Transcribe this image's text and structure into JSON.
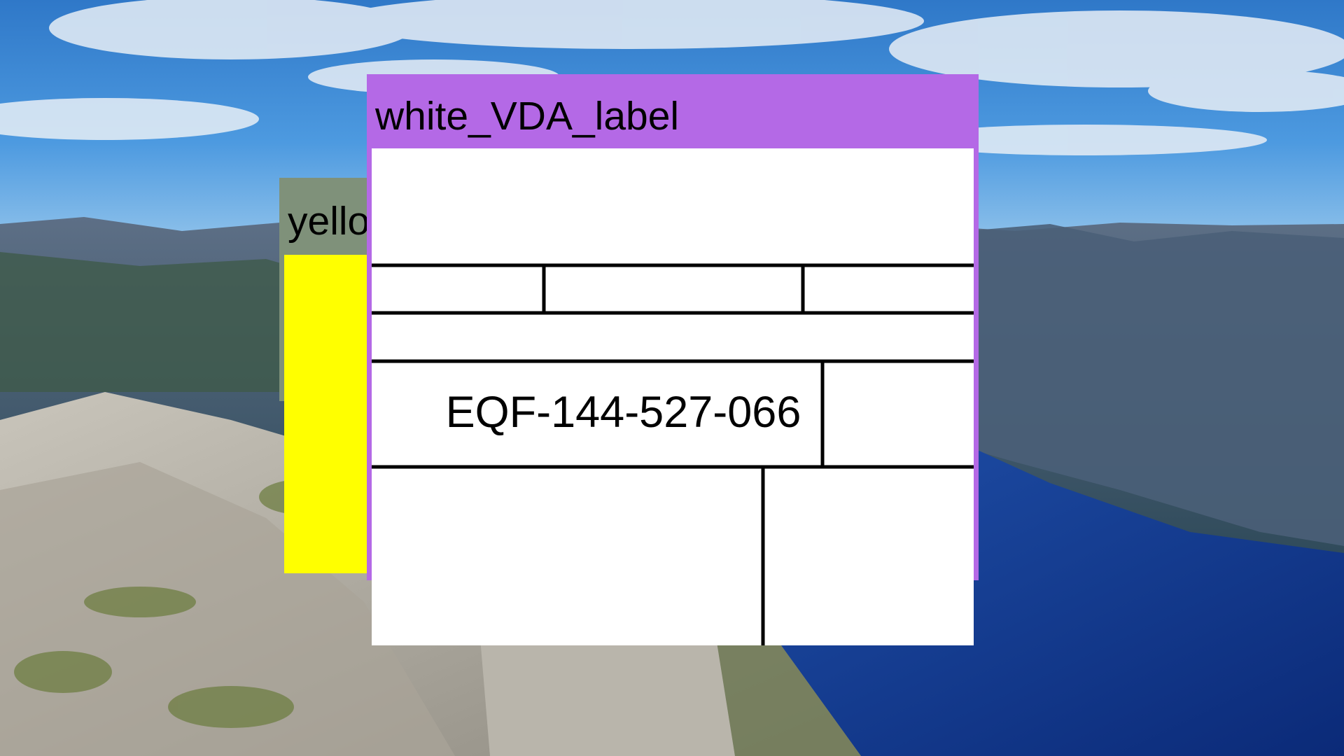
{
  "windows": {
    "yellow": {
      "title": "yellow_window",
      "content_color": "#ffff00",
      "frame_color": "#7f917a"
    },
    "white_vda_label": {
      "title": "white_VDA_label",
      "frame_color": "#b469e6",
      "content_color": "#ffffff",
      "label_id": "EQF-144-527-066"
    }
  }
}
